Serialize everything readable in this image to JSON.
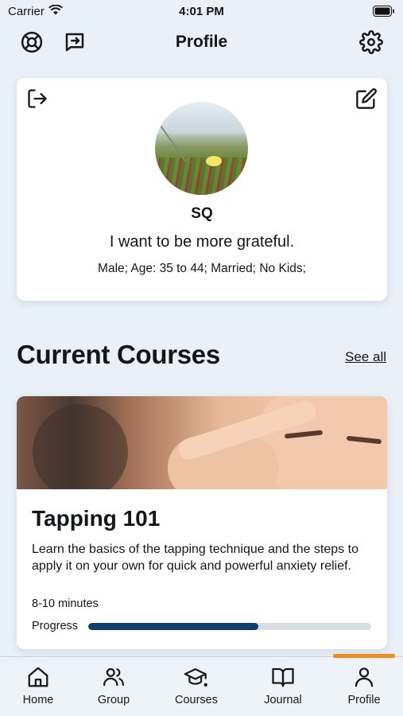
{
  "status_bar": {
    "carrier": "Carrier",
    "time": "4:01 PM"
  },
  "header": {
    "title": "Profile"
  },
  "profile": {
    "name": "SQ",
    "goal": "I want to be more grateful.",
    "demographics": "Male; Age: 35 to 44; Married; No Kids;"
  },
  "current_courses": {
    "title": "Current Courses",
    "see_all": "See all",
    "course": {
      "title": "Tapping 101",
      "description": "Learn the basics of the tapping technique and the steps to apply it on your own for quick and powerful anxiety relief.",
      "duration": "8-10 minutes",
      "progress_label": "Progress",
      "progress_fraction": 0.6
    }
  },
  "tabs": [
    {
      "label": "Home",
      "icon": "home-icon"
    },
    {
      "label": "Group",
      "icon": "group-icon"
    },
    {
      "label": "Courses",
      "icon": "graduation-cap-icon"
    },
    {
      "label": "Journal",
      "icon": "book-icon"
    },
    {
      "label": "Profile",
      "icon": "user-icon"
    }
  ],
  "colors": {
    "accent": "#f08a1d",
    "progress": "#123e6c",
    "background": "#eaf0f8"
  }
}
